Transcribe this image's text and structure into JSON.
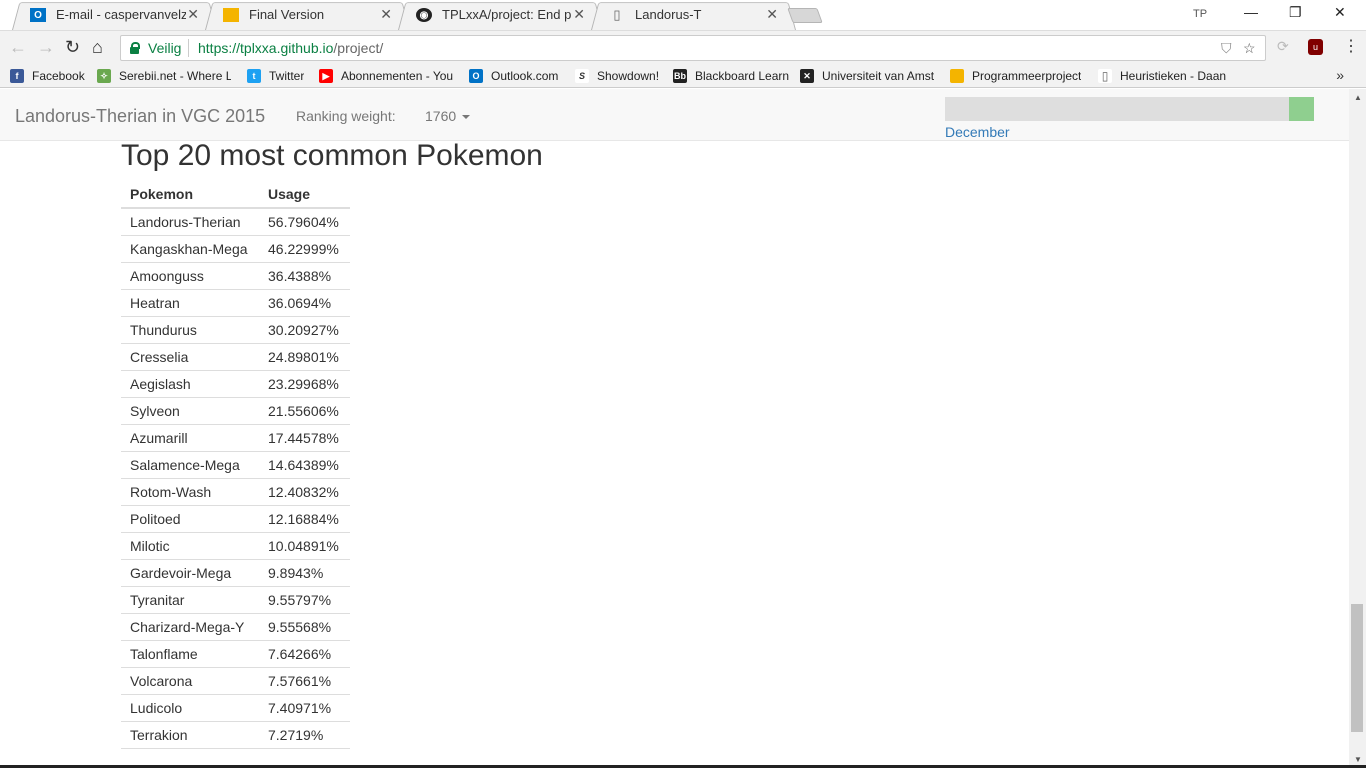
{
  "browser": {
    "tabs": [
      {
        "title": "E-mail - caspervanvelzen",
        "icon": "outlook-icon",
        "color": "#0072c6"
      },
      {
        "title": "Final Version",
        "icon": "slides-icon",
        "color": "#f4b400"
      },
      {
        "title": "TPLxxA/project: End proj",
        "icon": "github-icon",
        "color": "#222222"
      },
      {
        "title": "Landorus-T",
        "icon": "page-icon",
        "color": "#888888"
      }
    ],
    "profile_badge": "TP",
    "secure_label": "Veilig",
    "url_host": "https://tplxxa.github.io",
    "url_path": "/project/",
    "bookmarks": [
      {
        "label": "Facebook",
        "icon": "facebook-icon",
        "color": "#3b5998"
      },
      {
        "label": "Serebii.net - Where L",
        "icon": "serebii-icon",
        "color": "#6aa84f"
      },
      {
        "label": "Twitter",
        "icon": "twitter-icon",
        "color": "#1da1f2"
      },
      {
        "label": "Abonnementen - You",
        "icon": "youtube-icon",
        "color": "#ff0000"
      },
      {
        "label": "Outlook.com",
        "icon": "outlook-icon",
        "color": "#0072c6"
      },
      {
        "label": "Showdown!",
        "icon": "showdown-icon",
        "color": "#333333"
      },
      {
        "label": "Blackboard Learn",
        "icon": "blackboard-icon",
        "color": "#222222"
      },
      {
        "label": "Universiteit van Amst",
        "icon": "uva-icon",
        "color": "#222222"
      },
      {
        "label": "Programmeerproject",
        "icon": "slides-icon",
        "color": "#f4b400"
      },
      {
        "label": "Heuristieken - Daan",
        "icon": "page-icon",
        "color": "#888888"
      }
    ]
  },
  "navbar": {
    "brand": "Landorus-Therian in VGC 2015",
    "ranking_label": "Ranking weight:",
    "ranking_value": "1760",
    "month_label": "December",
    "slider_position": 1.0
  },
  "main": {
    "heading": "Top 20 most common Pokemon",
    "columns": [
      "Pokemon",
      "Usage"
    ],
    "rows": [
      [
        "Landorus-Therian",
        "56.79604%"
      ],
      [
        "Kangaskhan-Mega",
        "46.22999%"
      ],
      [
        "Amoonguss",
        "36.4388%"
      ],
      [
        "Heatran",
        "36.0694%"
      ],
      [
        "Thundurus",
        "30.20927%"
      ],
      [
        "Cresselia",
        "24.89801%"
      ],
      [
        "Aegislash",
        "23.29968%"
      ],
      [
        "Sylveon",
        "21.55606%"
      ],
      [
        "Azumarill",
        "17.44578%"
      ],
      [
        "Salamence-Mega",
        "14.64389%"
      ],
      [
        "Rotom-Wash",
        "12.40832%"
      ],
      [
        "Politoed",
        "12.16884%"
      ],
      [
        "Milotic",
        "10.04891%"
      ],
      [
        "Gardevoir-Mega",
        "9.8943%"
      ],
      [
        "Tyranitar",
        "9.55797%"
      ],
      [
        "Charizard-Mega-Y",
        "9.55568%"
      ],
      [
        "Talonflame",
        "7.64266%"
      ],
      [
        "Volcarona",
        "7.57661%"
      ],
      [
        "Ludicolo",
        "7.40971%"
      ],
      [
        "Terrakion",
        "7.2719%"
      ]
    ]
  }
}
